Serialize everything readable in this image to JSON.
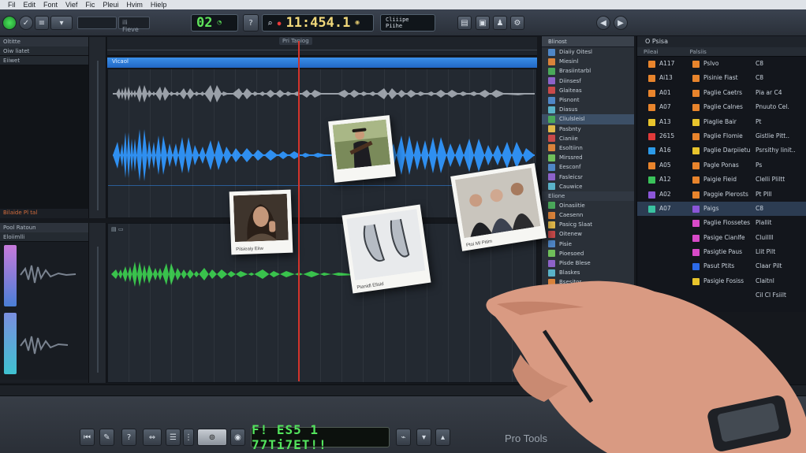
{
  "menubar": {
    "items": [
      "Fil",
      "Edit",
      "Font",
      "Vief",
      "Fic",
      "Pleui",
      "Hvim",
      "Hielp"
    ]
  },
  "toolbar": {
    "search_placeholder": "ili Fieve",
    "counter_small": "02",
    "main_counter": "11:454.1",
    "info_top": "Cliiipe",
    "info_bottom": "Piihe"
  },
  "ruler": {
    "marker_label": "Pri Taniog"
  },
  "left_top": {
    "header": "Oltitte",
    "sub_label": "Oiw liatet",
    "row": "Eiiwet",
    "footer": "Bilaide  Pl tal"
  },
  "left_bottom": {
    "header": "Pool Ratoun",
    "sub_label": "Eloiimlli"
  },
  "track1": {
    "label": "Vicaol"
  },
  "browser": {
    "header": "Blinost",
    "groups": [
      "Elione"
    ],
    "rows": [
      {
        "label": "Diaiiy Oitesl",
        "color": "#4f86c6"
      },
      {
        "label": "Miesinl",
        "color": "#d9823a"
      },
      {
        "label": "Brasiintarbl",
        "color": "#4aa85a"
      },
      {
        "label": "Diinsesf",
        "color": "#8d62c9"
      },
      {
        "label": "Glaiteas",
        "color": "#c94a4a"
      },
      {
        "label": "Pisnont",
        "color": "#4f86c6"
      },
      {
        "label": "Diasus",
        "color": "#5ab2c8"
      },
      {
        "label": "Cliulsleisl",
        "color": "#4aa85a"
      },
      {
        "label": "Pasbnty",
        "color": "#e0b84a"
      },
      {
        "label": "Cianiie",
        "color": "#c94a4a"
      },
      {
        "label": "Esoltiinn",
        "color": "#d9823a"
      },
      {
        "label": "Mirssred",
        "color": "#6fbf5a"
      },
      {
        "label": "Eesconf",
        "color": "#4f86c6"
      },
      {
        "label": "Fasleicsr",
        "color": "#8d62c9"
      },
      {
        "label": "Cauwice",
        "color": "#5ab2c8"
      },
      {
        "label": "Oinasiitie",
        "color": "#4aa85a"
      },
      {
        "label": "Caesenn",
        "color": "#d9823a"
      },
      {
        "label": "Pasicg Slaat",
        "color": "#e0b84a"
      },
      {
        "label": "Oitenew",
        "color": "#c94a4a"
      },
      {
        "label": "Pisie",
        "color": "#4f86c6"
      },
      {
        "label": "Pioesoed",
        "color": "#6fbf5a"
      },
      {
        "label": "Pisde Blese",
        "color": "#8d62c9"
      },
      {
        "label": "Blaskes",
        "color": "#5ab2c8"
      },
      {
        "label": "Bsesitor",
        "color": "#d9823a"
      }
    ]
  },
  "cliplist": {
    "title": "O Psisa",
    "col1": "Pileai",
    "col2": "Palsiis",
    "rows": [
      {
        "id": "A117",
        "name": "Pslvo",
        "meta": "C8",
        "c1": "#e8842c",
        "c2": "#e8842c"
      },
      {
        "id": "Ai13",
        "name": "Pisinie Fiast",
        "meta": "C8",
        "c1": "#e8842c",
        "c2": "#e8842c"
      },
      {
        "id": "A01",
        "name": "Paglie Caetrs",
        "meta": "Pia ar C4",
        "c1": "#e8842c",
        "c2": "#e8842c"
      },
      {
        "id": "A07",
        "name": "Paglie Calnes",
        "meta": "Pnuuto Cel.",
        "c1": "#e8842c",
        "c2": "#e8842c"
      },
      {
        "id": "A13",
        "name": "Piaglie Bair",
        "meta": "Pt",
        "c1": "#e8c42c",
        "c2": "#e8c42c"
      },
      {
        "id": "2615",
        "name": "Paglie Flomie",
        "meta": "Gistlie Pitt..",
        "c1": "#e03a3a",
        "c2": "#e8842c"
      },
      {
        "id": "A16",
        "name": "Paglie Darpiietu",
        "meta": "Psrsithy linit..",
        "c1": "#2c9ae8",
        "c2": "#e8c42c"
      },
      {
        "id": "A05",
        "name": "Pagle Ponas",
        "meta": "Ps",
        "c1": "#e8842c",
        "c2": "#e8842c"
      },
      {
        "id": "A12",
        "name": "Paigie Fieid",
        "meta": "Clelli Pliltt",
        "c1": "#3ac25a",
        "c2": "#e8842c"
      },
      {
        "id": "A02",
        "name": "Paggie Plerosts",
        "meta": "Pt Plll",
        "c1": "#8b56d8",
        "c2": "#e8842c"
      },
      {
        "id": "A07",
        "name": "Paigs",
        "meta": "C8",
        "c1": "#3ac2a0",
        "c2": "#8b56d8"
      },
      {
        "id": "",
        "name": "Paglie Fiossetes",
        "meta": "Plallit",
        "c1": "",
        "c2": "#d84ac8"
      },
      {
        "id": "",
        "name": "Pasige Cianlfe",
        "meta": "Cluillll",
        "c1": "",
        "c2": "#d84ac8"
      },
      {
        "id": "",
        "name": "Pasigtie Paus",
        "meta": "Llit Pilt",
        "c1": "",
        "c2": "#d84ac8"
      },
      {
        "id": "",
        "name": "Pasut Ptits",
        "meta": "Claar Pilt",
        "c1": "",
        "c2": "#2c6ae8"
      },
      {
        "id": "",
        "name": "Pasigie Fosiss",
        "meta": "Claitnl",
        "c1": "",
        "c2": "#e8c42c"
      },
      {
        "id": "",
        "name": "",
        "meta": "Cil Cl Fsiilt",
        "c1": "",
        "c2": ""
      }
    ]
  },
  "photos": {
    "p1_caption": "",
    "p2_caption": "Pilsieaiy Eiiw",
    "p3_caption": "Ptanidl Ellsid",
    "p4_caption": "Ptoi Ml Pitim"
  },
  "bottom": {
    "counter": "F! ES5 1 77Ti7ET!!",
    "brand": "Pro Tools"
  },
  "colors": {
    "accent_blue": "#2e7fe0",
    "accent_green": "#3ac24a",
    "playhead": "#d4342c"
  }
}
